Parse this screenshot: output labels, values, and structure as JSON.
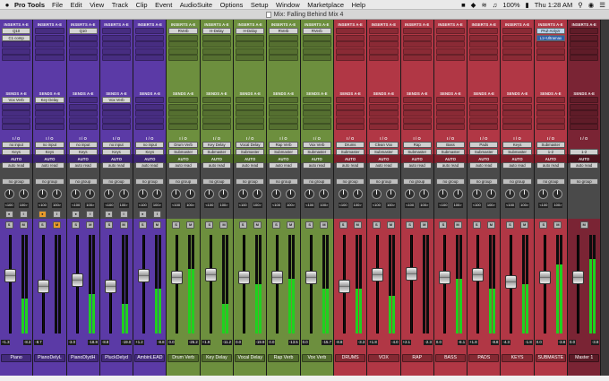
{
  "menubar": {
    "apple": "",
    "app": "Pro Tools",
    "items": [
      "File",
      "Edit",
      "View",
      "Track",
      "Clip",
      "Event",
      "AudioSuite",
      "Options",
      "Setup",
      "Window",
      "Marketplace",
      "Help"
    ],
    "battery": "100%",
    "clock": "Thu 1:28 AM"
  },
  "window": {
    "title": "Mix: Falling Behind Mix 4"
  },
  "section_labels": {
    "inserts": "INSERTS A-E",
    "sends": "SENDS A-E",
    "io": "I / O",
    "auto": "AUTO",
    "auto_mode": "auto read",
    "group": "no group"
  },
  "colors": {
    "purple": "#4a2f8f",
    "green": "#5a7a33",
    "red": "#9b2c38",
    "master": "#6b2030"
  },
  "tracks": [
    {
      "name": "Piano",
      "color": "purple",
      "insert": "Q10",
      "insert2": "C1 comp",
      "send": "Vox Verb",
      "input": "no input",
      "output": "Keys",
      "vol": "+1.3",
      "peak": "-8.3",
      "fader": 0.62,
      "meter": 0.35,
      "pan_l": "<100",
      "pan_r": "100>",
      "rec": true
    },
    {
      "name": "PianoDelyL",
      "color": "purple",
      "insert": "",
      "insert2": "",
      "send": "Key Delay",
      "input": "no input",
      "output": "Keys",
      "vol": "-8.7",
      "peak": "",
      "fader": 0.5,
      "meter": 0.0,
      "pan_l": "<100",
      "pan_r": "100>",
      "rec": false
    },
    {
      "name": "PianoDlydH",
      "color": "purple",
      "insert": "Q10",
      "insert2": "",
      "send": "",
      "input": "no input",
      "output": "Keys",
      "vol": "-3.0",
      "peak": "-18.8",
      "fader": 0.57,
      "meter": 0.4,
      "pan_l": "<100",
      "pan_r": "100>",
      "rec": false
    },
    {
      "name": "PluckDelyd",
      "color": "purple",
      "insert": "",
      "insert2": "",
      "send": "Vox Verb",
      "input": "no input",
      "output": "Keys",
      "vol": "-8.8",
      "peak": "-19.0",
      "fader": 0.5,
      "meter": 0.3,
      "pan_l": "<100",
      "pan_r": "100>",
      "rec": false
    },
    {
      "name": "AmbinLEAD",
      "color": "purple",
      "insert": "",
      "insert2": "",
      "send": "",
      "input": "no input",
      "output": "Keys",
      "vol": "+1.2",
      "peak": "-8.8",
      "fader": 0.62,
      "meter": 0.45,
      "pan_l": "<100",
      "pan_r": "100>",
      "rec": false
    },
    {
      "name": "Drum Verb",
      "color": "green",
      "insert": "RVerb",
      "insert2": "",
      "send": "",
      "input": "Drum Verb",
      "output": "Submaster",
      "vol": "0.0",
      "peak": "-26.2",
      "fader": 0.6,
      "meter": 0.65,
      "pan_l": "<100",
      "pan_r": "100>",
      "rec": false
    },
    {
      "name": "Key Delay",
      "color": "green",
      "insert": "H-Delay",
      "insert2": "",
      "send": "",
      "input": "Key Delay",
      "output": "Submaster",
      "vol": "+1.9",
      "peak": "-11.2",
      "fader": 0.63,
      "meter": 0.3,
      "pan_l": "<100",
      "pan_r": "100>",
      "rec": false
    },
    {
      "name": "Vocal Delay",
      "color": "green",
      "insert": "H-Delay",
      "insert2": "",
      "send": "",
      "input": "Vocal Delay",
      "output": "Submaster",
      "vol": "0.0",
      "peak": "-19.9",
      "fader": 0.6,
      "meter": 0.5,
      "pan_l": "<100",
      "pan_r": "100>",
      "rec": false
    },
    {
      "name": "Rap Verb",
      "color": "green",
      "insert": "RVerb",
      "insert2": "",
      "send": "",
      "input": "Rap Verb",
      "output": "Submaster",
      "vol": "0.0",
      "peak": "-13.5",
      "fader": 0.6,
      "meter": 0.55,
      "pan_l": "<100",
      "pan_r": "100>",
      "rec": false
    },
    {
      "name": "Vox Verb",
      "color": "green",
      "insert": "RVerb",
      "insert2": "",
      "send": "",
      "input": "Vox Verb",
      "output": "Submaster",
      "vol": "0.0",
      "peak": "-15.7",
      "fader": 0.6,
      "meter": 0.45,
      "pan_l": "<100",
      "pan_r": "100>",
      "rec": false
    },
    {
      "name": "DRUMS",
      "color": "red",
      "insert": "",
      "insert2": "",
      "send": "",
      "input": "Drums",
      "output": "Submaster",
      "vol": "-8.8",
      "peak": "-3.3",
      "fader": 0.5,
      "meter": 0.45,
      "pan_l": "<100",
      "pan_r": "100>",
      "rec": false
    },
    {
      "name": "VOX",
      "color": "red",
      "insert": "",
      "insert2": "",
      "send": "",
      "input": "Clean Vox",
      "output": "Submaster",
      "vol": "+1.8",
      "peak": "-4.0",
      "fader": 0.63,
      "meter": 0.38,
      "pan_l": "<100",
      "pan_r": "100>",
      "rec": false
    },
    {
      "name": "RAP",
      "color": "red",
      "insert": "",
      "insert2": "",
      "send": "",
      "input": "Rap",
      "output": "Submaster",
      "vol": "+2.1",
      "peak": "-2.3",
      "fader": 0.64,
      "meter": 0.0,
      "pan_l": "<100",
      "pan_r": "100>",
      "rec": false
    },
    {
      "name": "BASS",
      "color": "red",
      "insert": "",
      "insert2": "",
      "send": "",
      "input": "Bass",
      "output": "Submaster",
      "vol": "0.0",
      "peak": "-6.1",
      "fader": 0.6,
      "meter": 0.55,
      "pan_l": "<100",
      "pan_r": "100>",
      "rec": false
    },
    {
      "name": "PADS",
      "color": "red",
      "insert": "",
      "insert2": "",
      "send": "",
      "input": "Pads",
      "output": "Submaster",
      "vol": "+1.8",
      "peak": "-8.8",
      "fader": 0.63,
      "meter": 0.45,
      "pan_l": "<100",
      "pan_r": "100>",
      "rec": false
    },
    {
      "name": "KEYS",
      "color": "red",
      "insert": "",
      "insert2": "",
      "send": "",
      "input": "Keys",
      "output": "Submaster",
      "vol": "-4.3",
      "peak": "-1.8",
      "fader": 0.55,
      "meter": 0.5,
      "pan_l": "<100",
      "pan_r": "100>",
      "rec": false
    },
    {
      "name": "SUBMASTE",
      "color": "red",
      "insert": "PAZ-Anlyzr",
      "insert2": "L1+Ultramax",
      "send": "",
      "input": "Submaster",
      "output": "1-2",
      "vol": "0.0",
      "peak": "-3.8",
      "fader": 0.6,
      "meter": 0.7,
      "pan_l": "<100",
      "pan_r": "100>",
      "rec": false
    },
    {
      "name": "Master 1",
      "color": "master",
      "insert": "",
      "insert2": "",
      "send": "",
      "input": "",
      "output": "1-2",
      "vol": "0.0",
      "peak": "-3.8",
      "fader": 0.6,
      "meter": 0.75,
      "pan_l": "",
      "pan_r": "",
      "rec": false
    }
  ]
}
